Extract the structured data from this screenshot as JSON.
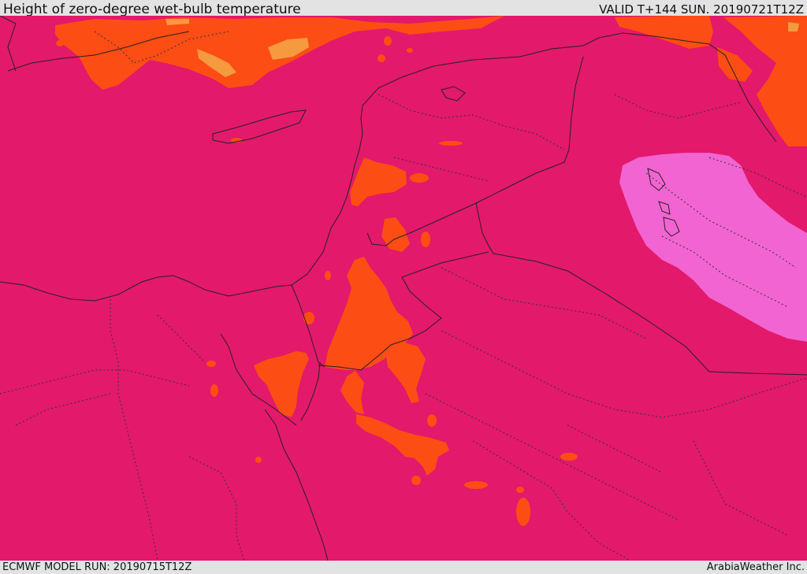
{
  "header": {
    "title": "Height of zero-degree wet-bulb temperature",
    "valid": "VALID T+144 SUN. 20190721T12Z"
  },
  "footer": {
    "model_run": "ECMWF MODEL RUN: 20190715T12Z",
    "credit": "ArabiaWeather Inc."
  },
  "colors": {
    "dominant_field": "#e3196b",
    "orange": "#fc4d14",
    "light_orange": "#f59a3e",
    "pink": "#f264d2",
    "border_lines": "#222222"
  }
}
